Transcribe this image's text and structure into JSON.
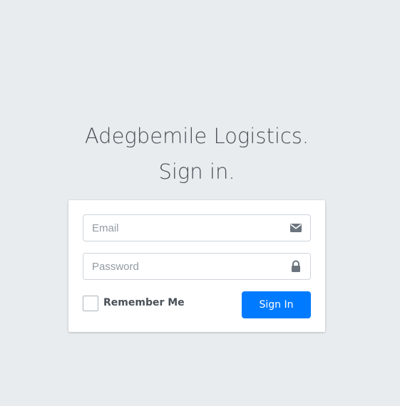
{
  "header": {
    "title_line1": "Adegbemile Logistics.",
    "title_line2": "Sign in."
  },
  "form": {
    "email": {
      "placeholder": "Email",
      "value": "",
      "icon": "envelope-icon"
    },
    "password": {
      "placeholder": "Password",
      "value": "",
      "icon": "lock-icon"
    },
    "remember_me": {
      "label": "Remember Me",
      "checked": false
    },
    "submit_label": "Sign In"
  },
  "colors": {
    "background": "#e9ecef",
    "card": "#ffffff",
    "primary": "#007bff",
    "text": "#495057",
    "icon": "#6c757d"
  }
}
